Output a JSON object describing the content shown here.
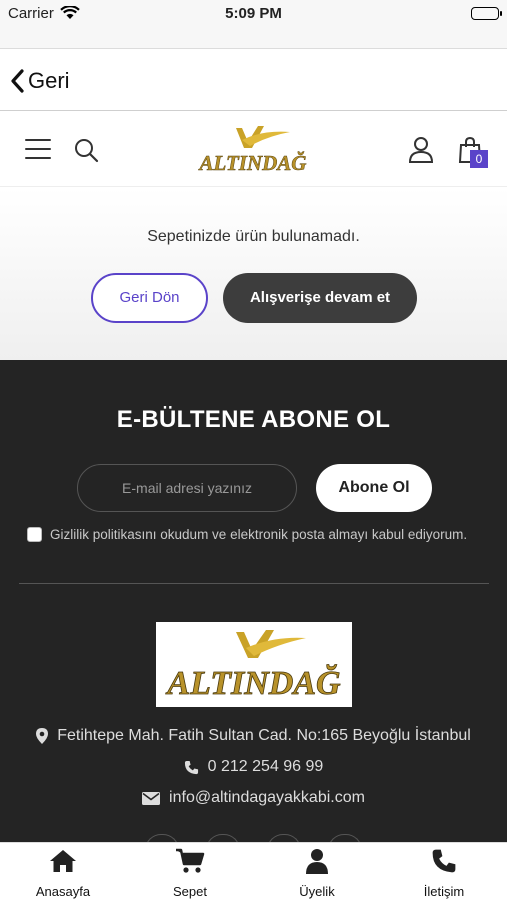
{
  "status_bar": {
    "carrier": "Carrier",
    "time": "5:09 PM"
  },
  "nav": {
    "back_label": "Geri"
  },
  "header": {
    "logo_text": "ALTINDAĞ",
    "cart_count": "0"
  },
  "cart": {
    "empty_message": "Sepetinizde ürün bulunamadı.",
    "back_button": "Geri Dön",
    "continue_button": "Alışverişe devam et"
  },
  "newsletter": {
    "title": "E-BÜLTENE ABONE OL",
    "email_placeholder": "E-mail adresi yazınız",
    "subscribe_button": "Abone Ol",
    "consent_text": "Gizlilik politikasını okudum ve elektronik posta almayı kabul ediyorum."
  },
  "footer": {
    "logo_text": "ALTINDAĞ",
    "address": "Fetihtepe Mah. Fatih Sultan Cad. No:165 Beyoğlu İstanbul",
    "phone": "0 212 254 96 99",
    "email": "info@altindagayakkabi.com"
  },
  "tab_bar": {
    "items": [
      {
        "label": "Anasayfa",
        "icon": "home-icon"
      },
      {
        "label": "Sepet",
        "icon": "cart-icon"
      },
      {
        "label": "Üyelik",
        "icon": "user-icon"
      },
      {
        "label": "İletişim",
        "icon": "phone-icon"
      }
    ]
  },
  "colors": {
    "accent": "#5a43c9",
    "footer_bg": "#242424",
    "dark_button": "#3d3d3d",
    "logo_gold": "#c9a227"
  }
}
